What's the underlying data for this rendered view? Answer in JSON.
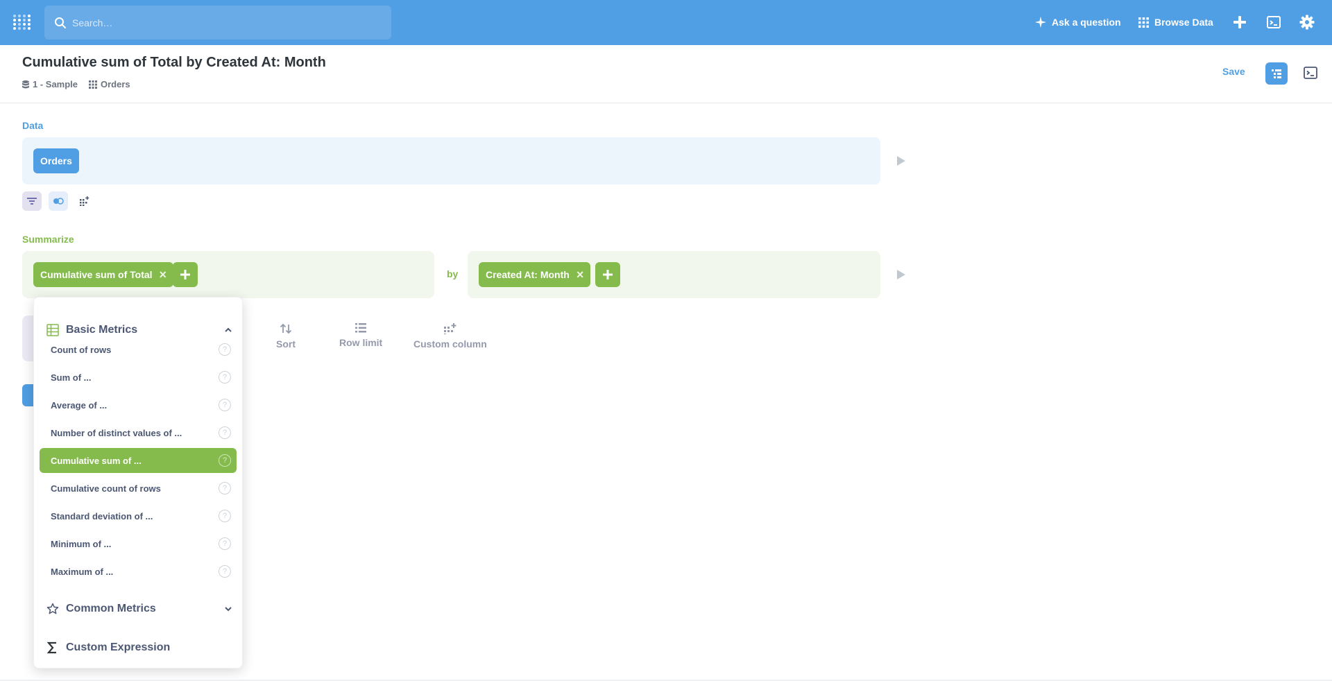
{
  "colors": {
    "brand": "#509ee3",
    "summarize": "#84bb4c",
    "text": "#2e353b"
  },
  "nav": {
    "search_placeholder": "Search…",
    "ask_label": "Ask a question",
    "browse_label": "Browse Data",
    "icons": [
      "sparkle-icon",
      "grid-icon",
      "plus-icon",
      "terminal-icon",
      "gear-icon"
    ]
  },
  "header": {
    "title": "Cumulative sum of Total by Created At: Month",
    "breadcrumbs": [
      {
        "label": "1 - Sample",
        "icon": "database-icon"
      },
      {
        "label": "Orders",
        "icon": "table-grid-icon"
      }
    ],
    "save_label": "Save"
  },
  "notebook": {
    "data_label": "Data",
    "data_table": "Orders",
    "summarize_label": "Summarize",
    "metric": "Cumulative sum of Total",
    "by_label": "by",
    "breakout": "Created At: Month",
    "steps": [
      "Sort",
      "Row limit",
      "Custom column"
    ]
  },
  "popover": {
    "basic_group": "Basic Metrics",
    "items": [
      {
        "label": "Count of rows"
      },
      {
        "label": "Sum of ..."
      },
      {
        "label": "Average of ..."
      },
      {
        "label": "Number of distinct values of ..."
      },
      {
        "label": "Cumulative sum of ...",
        "selected": true
      },
      {
        "label": "Cumulative count of rows"
      },
      {
        "label": "Standard deviation of ..."
      },
      {
        "label": "Minimum of ..."
      },
      {
        "label": "Maximum of ..."
      }
    ],
    "help_glyph": "?",
    "common_group": "Common Metrics",
    "custom_group": "Custom Expression"
  }
}
